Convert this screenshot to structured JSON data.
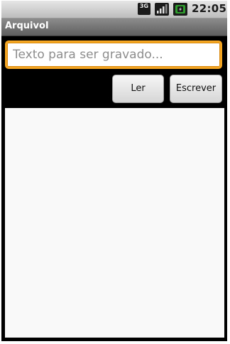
{
  "status_bar": {
    "network": "3G",
    "time": "22:05"
  },
  "app": {
    "title": "ArquivoI"
  },
  "main": {
    "input": {
      "value": "",
      "placeholder": "Texto para ser gravado..."
    },
    "buttons": {
      "read_label": "Ler",
      "write_label": "Escrever"
    },
    "output_text": ""
  },
  "colors": {
    "status_bar": "#cfcfcf",
    "title_bar": "#707070",
    "background": "#000000",
    "input_focus_border": "#f5a623",
    "output_area": "#f9f9f9"
  },
  "icons": [
    "3g-icon",
    "signal-icon",
    "battery-charging-icon"
  ]
}
